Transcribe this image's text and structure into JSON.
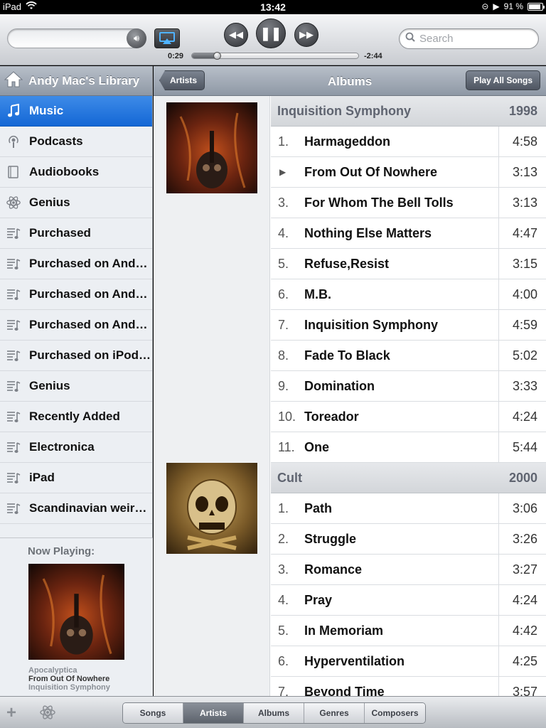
{
  "status": {
    "device": "iPad",
    "time": "13:42",
    "battery": "91 %",
    "battery_level": 0.91
  },
  "player": {
    "elapsed": "0:29",
    "remaining": "-2:44",
    "progress": 0.15,
    "search_placeholder": "Search"
  },
  "sidebar": {
    "title": "Andy Mac's Library",
    "items": [
      {
        "label": "Music",
        "icon": "music-note-icon",
        "selected": true
      },
      {
        "label": "Podcasts",
        "icon": "podcast-icon"
      },
      {
        "label": "Audiobooks",
        "icon": "book-icon"
      },
      {
        "label": "Genius",
        "icon": "genius-atom-icon"
      },
      {
        "label": "Purchased",
        "icon": "playlist-icon"
      },
      {
        "label": "Purchased on And…",
        "icon": "playlist-icon"
      },
      {
        "label": "Purchased on And…",
        "icon": "playlist-icon"
      },
      {
        "label": "Purchased on And…",
        "icon": "playlist-icon"
      },
      {
        "label": "Purchased on iPod…",
        "icon": "playlist-icon"
      },
      {
        "label": "Genius",
        "icon": "playlist-icon"
      },
      {
        "label": "Recently Added",
        "icon": "playlist-icon"
      },
      {
        "label": "Electronica",
        "icon": "playlist-icon"
      },
      {
        "label": "iPad",
        "icon": "playlist-icon"
      },
      {
        "label": "Scandinavian weir…",
        "icon": "playlist-icon"
      }
    ],
    "now_playing": {
      "title": "Now Playing:",
      "artist": "Apocalyptica",
      "song": "From Out Of Nowhere",
      "album": "Inquisition Symphony"
    }
  },
  "main": {
    "back_label": "Artists",
    "title": "Albums",
    "play_all_label": "Play All Songs",
    "albums": [
      {
        "name": "Inquisition Symphony",
        "year": "1998",
        "tracks": [
          {
            "num": "1.",
            "name": "Harmageddon",
            "dur": "4:58"
          },
          {
            "num": "▶",
            "name": "From Out Of Nowhere",
            "dur": "3:13",
            "playing": true
          },
          {
            "num": "3.",
            "name": "For Whom The Bell Tolls",
            "dur": "3:13"
          },
          {
            "num": "4.",
            "name": "Nothing Else Matters",
            "dur": "4:47"
          },
          {
            "num": "5.",
            "name": "Refuse,Resist",
            "dur": "3:15"
          },
          {
            "num": "6.",
            "name": "M.B.",
            "dur": "4:00"
          },
          {
            "num": "7.",
            "name": "Inquisition Symphony",
            "dur": "4:59"
          },
          {
            "num": "8.",
            "name": "Fade To Black",
            "dur": "5:02"
          },
          {
            "num": "9.",
            "name": "Domination",
            "dur": "3:33"
          },
          {
            "num": "10.",
            "name": "Toreador",
            "dur": "4:24"
          },
          {
            "num": "11.",
            "name": "One",
            "dur": "5:44"
          }
        ]
      },
      {
        "name": "Cult",
        "year": "2000",
        "tracks": [
          {
            "num": "1.",
            "name": "Path",
            "dur": "3:06"
          },
          {
            "num": "2.",
            "name": "Struggle",
            "dur": "3:26"
          },
          {
            "num": "3.",
            "name": "Romance",
            "dur": "3:27"
          },
          {
            "num": "4.",
            "name": "Pray",
            "dur": "4:24"
          },
          {
            "num": "5.",
            "name": "In Memoriam",
            "dur": "4:42"
          },
          {
            "num": "6.",
            "name": "Hyperventilation",
            "dur": "4:25"
          },
          {
            "num": "7.",
            "name": "Beyond Time",
            "dur": "3:57"
          }
        ]
      }
    ]
  },
  "tabs": [
    "Songs",
    "Artists",
    "Albums",
    "Genres",
    "Composers"
  ],
  "active_tab": "Artists",
  "colors": {
    "selection": "#1f72dc",
    "header": "#9aa3af"
  }
}
